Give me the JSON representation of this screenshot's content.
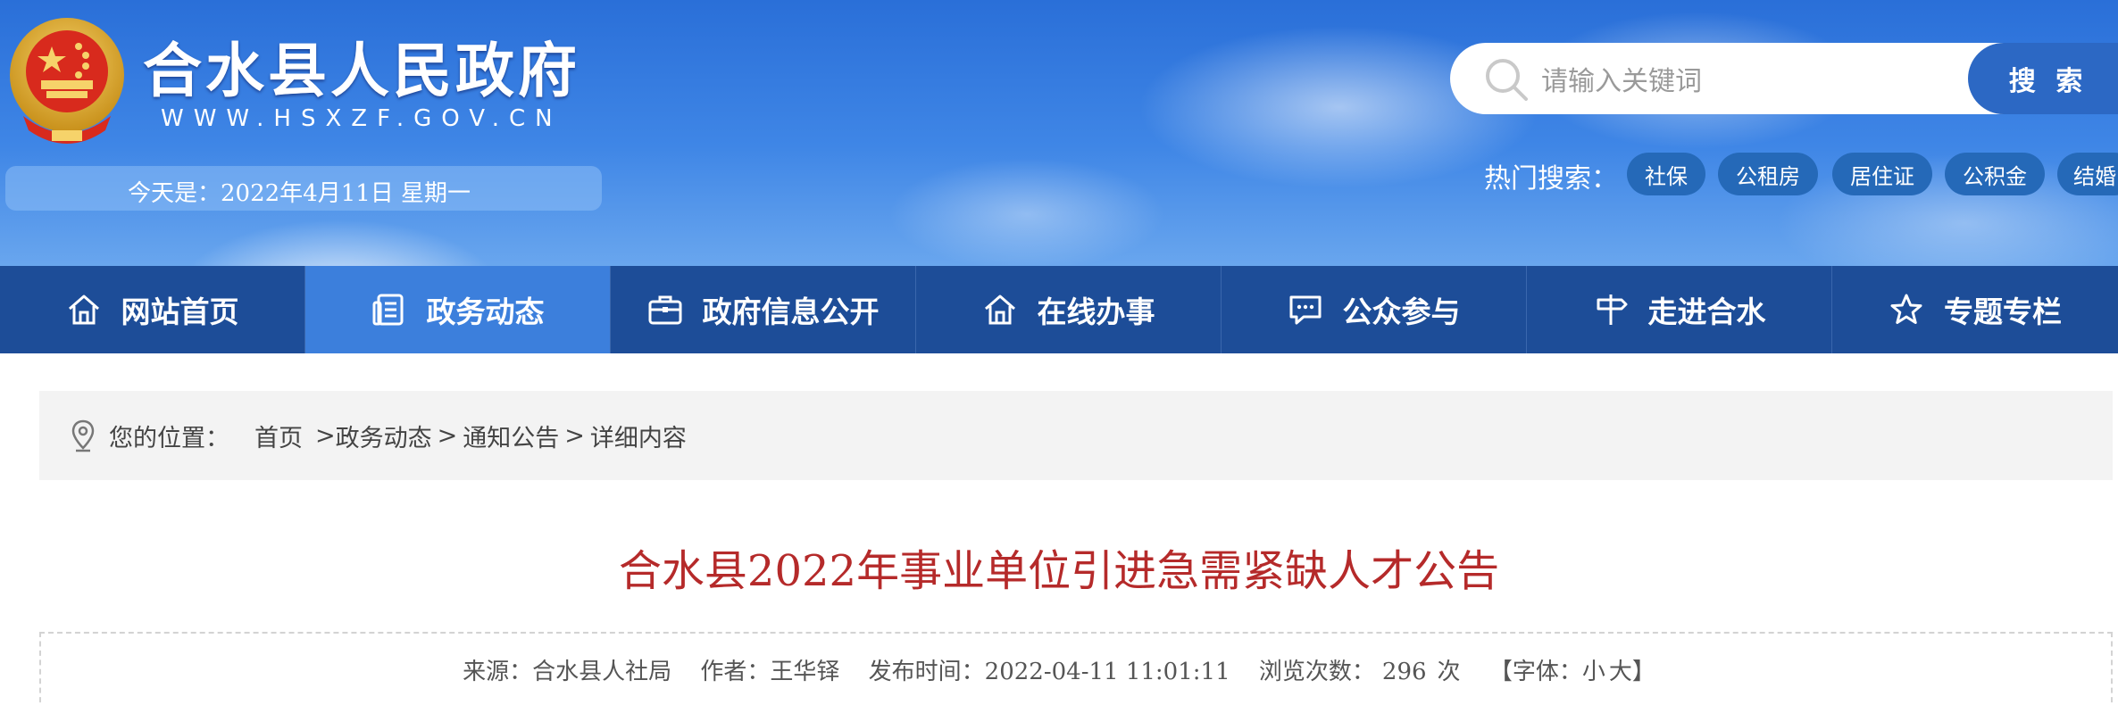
{
  "header": {
    "site_title": "合水县人民政府",
    "site_url": "WWW.HSXZF.GOV.CN",
    "date_text": "今天是：2022年4月11日 星期一",
    "search": {
      "placeholder": "请输入关键词",
      "button_label": "搜 索"
    },
    "hot_search": {
      "label": "热门搜索：",
      "tags": [
        "社保",
        "公租房",
        "居住证",
        "公积金",
        "结婚"
      ]
    }
  },
  "nav": {
    "items": [
      {
        "label": "网站首页",
        "icon": "home-icon"
      },
      {
        "label": "政务动态",
        "icon": "document-list-icon",
        "active": true
      },
      {
        "label": "政府信息公开",
        "icon": "briefcase-icon"
      },
      {
        "label": "在线办事",
        "icon": "home-icon"
      },
      {
        "label": "公众参与",
        "icon": "chat-icon"
      },
      {
        "label": "走进合水",
        "icon": "signpost-icon"
      },
      {
        "label": "专题专栏",
        "icon": "star-icon"
      }
    ]
  },
  "breadcrumb": {
    "prefix": "您的位置：",
    "items": [
      "首页",
      "政务动态",
      "通知公告",
      "详细内容"
    ],
    "separator": ">"
  },
  "article": {
    "title": "合水县2022年事业单位引进急需紧缺人才公告",
    "meta": {
      "source": "来源：合水县人社局",
      "author": "作者：王华铎",
      "publish_time": "发布时间：2022-04-11 11:01:11",
      "views_label": "浏览次数：",
      "views": "296",
      "views_unit": "次",
      "font_prefix": "【字体：",
      "font_small": "小",
      "font_large": "大",
      "font_suffix": "】"
    }
  },
  "colors": {
    "nav_bg": "#1d4d98",
    "nav_active": "#3c7fdc",
    "title_red": "#b52a2a",
    "search_button": "#2c68c4",
    "hot_tag": "#2569b8"
  }
}
